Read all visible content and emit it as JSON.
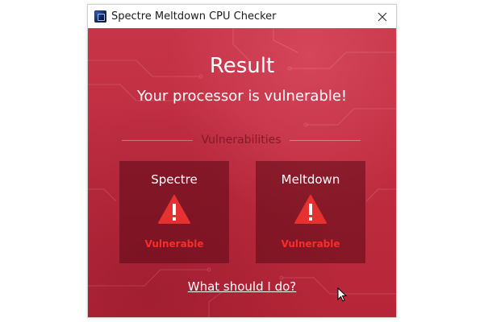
{
  "window": {
    "title": "Spectre Meltdown CPU Checker",
    "app_icon": "spectre-meltdown-app-icon",
    "close_icon": "close-icon"
  },
  "result": {
    "heading": "Result",
    "message": "Your processor is vulnerable!"
  },
  "vulnerabilities": {
    "section_label": "Vulnerabilities",
    "items": [
      {
        "name": "Spectre",
        "status": "Vulnerable",
        "icon": "warning-icon"
      },
      {
        "name": "Meltdown",
        "status": "Vulnerable",
        "icon": "warning-icon"
      }
    ]
  },
  "help": {
    "link_text": "What should I do?"
  },
  "colors": {
    "background_red": "#c0303f",
    "card_dark": "#5a0a16",
    "status_red": "#ff2a2a",
    "warning_red": "#e5312f",
    "section_label": "#7a1426"
  }
}
